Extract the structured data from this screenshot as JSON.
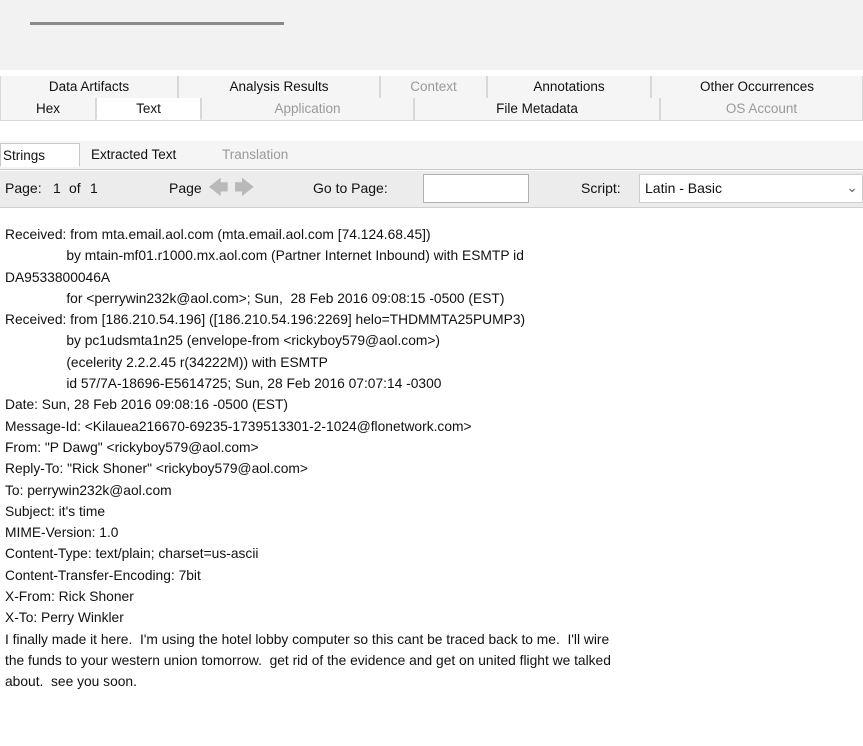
{
  "tabs_row1": [
    {
      "label": "Data Artifacts",
      "disabled": false
    },
    {
      "label": "Analysis Results",
      "disabled": false
    },
    {
      "label": "Context",
      "disabled": true
    },
    {
      "label": "Annotations",
      "disabled": false
    },
    {
      "label": "Other Occurrences",
      "disabled": false
    }
  ],
  "tabs_row2": [
    {
      "label": "Hex",
      "disabled": false
    },
    {
      "label": "Text",
      "disabled": false,
      "selected": true
    },
    {
      "label": "Application",
      "disabled": true
    },
    {
      "label": "File Metadata",
      "disabled": false
    },
    {
      "label": "OS Account",
      "disabled": true
    }
  ],
  "subtabs": [
    {
      "label": "Strings",
      "selected": true,
      "disabled": false
    },
    {
      "label": "Extracted Text",
      "selected": false,
      "disabled": false
    },
    {
      "label": "Translation",
      "selected": false,
      "disabled": true
    }
  ],
  "toolbar": {
    "page_label": "Page:",
    "page_current": "1",
    "page_of": "of",
    "page_total": "1",
    "page_nav_label": "Page",
    "prev_icon": "left-arrow",
    "next_icon": "right-arrow",
    "goto_label": "Go to Page:",
    "goto_value": "",
    "script_label": "Script:",
    "script_value": "Latin - Basic"
  },
  "content_lines": [
    "Received: from mta.email.aol.com (mta.email.aol.com [74.124.68.45])",
    "                by mtain-mf01.r1000.mx.aol.com (Partner Internet Inbound) with ESMTP id",
    "DA9533800046A",
    "                for <perrywin232k@aol.com>; Sun,  28 Feb 2016 09:08:15 -0500 (EST)",
    "Received: from [186.210.54.196] ([186.210.54.196:2269] helo=THDMMTA25PUMP3)",
    "                by pc1udsmta1n25 (envelope-from <rickyboy579@aol.com>)",
    "                (ecelerity 2.2.2.45 r(34222M)) with ESMTP",
    "                id 57/7A-18696-E5614725; Sun, 28 Feb 2016 07:07:14 -0300",
    "Date: Sun, 28 Feb 2016 09:08:16 -0500 (EST)",
    "Message-Id: <Kilauea216670-69235-1739513301-2-1024@flonetwork.com>",
    "From: \"P Dawg\" <rickyboy579@aol.com>",
    "Reply-To: \"Rick Shoner\" <rickyboy579@aol.com>",
    "To: perrywin232k@aol.com",
    "Subject: it's time",
    "MIME-Version: 1.0",
    "Content-Type: text/plain; charset=us-ascii",
    "Content-Transfer-Encoding: 7bit",
    "X-From: Rick Shoner",
    "X-To: Perry Winkler",
    "I finally made it here.  I'm using the hotel lobby computer so this cant be traced back to me.  I'll wire",
    "the funds to your western union tomorrow.  get rid of the evidence and get on united flight we talked",
    "about.  see you soon."
  ]
}
